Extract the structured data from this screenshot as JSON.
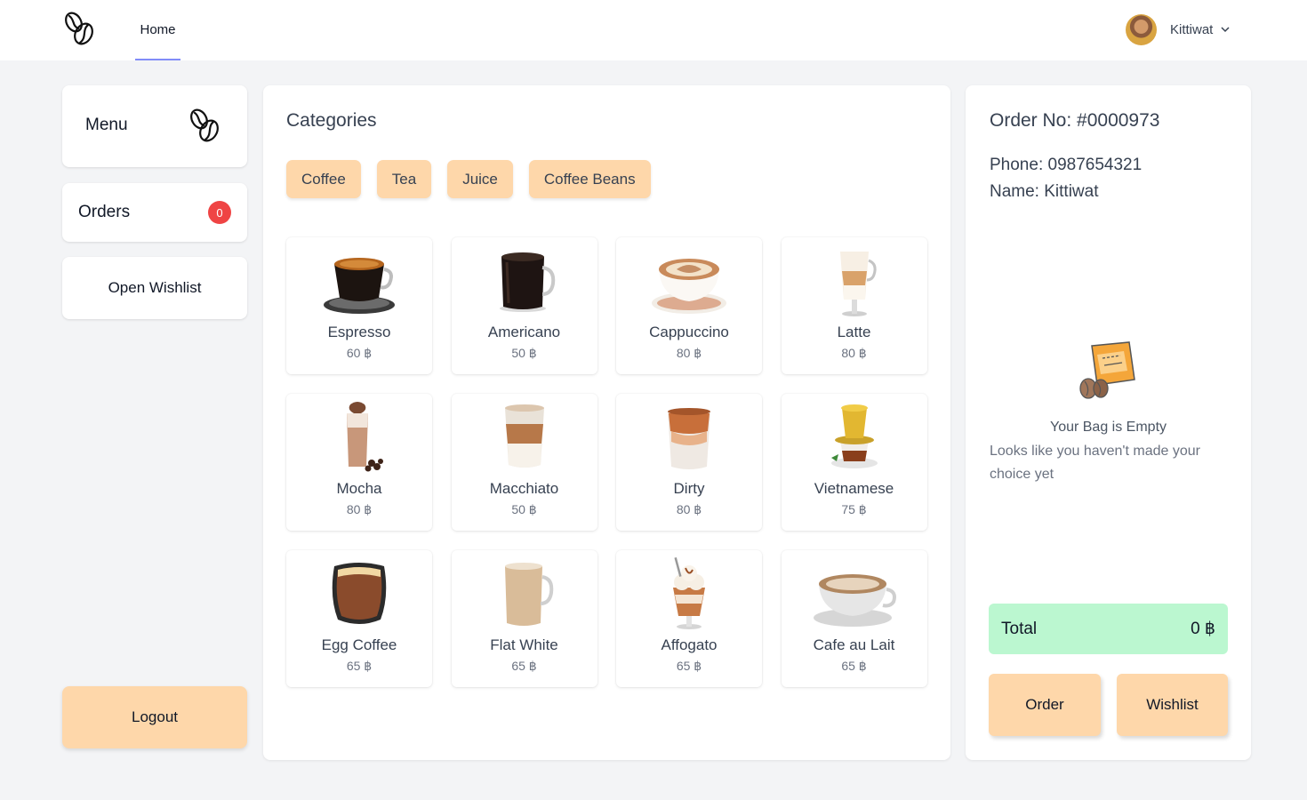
{
  "nav": {
    "home_label": "Home",
    "user_name": "Kittiwat"
  },
  "sidebar": {
    "menu_label": "Menu",
    "orders_label": "Orders",
    "orders_count": "0",
    "wishlist_label": "Open Wishlist",
    "logout_label": "Logout"
  },
  "main": {
    "categories_title": "Categories",
    "categories": [
      "Coffee",
      "Tea",
      "Juice",
      "Coffee Beans"
    ],
    "products": [
      {
        "name": "Espresso",
        "price": "60 ฿",
        "icon": "espresso-icon"
      },
      {
        "name": "Americano",
        "price": "50 ฿",
        "icon": "americano-icon"
      },
      {
        "name": "Cappuccino",
        "price": "80 ฿",
        "icon": "cappuccino-icon"
      },
      {
        "name": "Latte",
        "price": "80 ฿",
        "icon": "latte-icon"
      },
      {
        "name": "Mocha",
        "price": "80 ฿",
        "icon": "mocha-icon"
      },
      {
        "name": "Macchiato",
        "price": "50 ฿",
        "icon": "macchiato-icon"
      },
      {
        "name": "Dirty",
        "price": "80 ฿",
        "icon": "dirty-icon"
      },
      {
        "name": "Vietnamese",
        "price": "75 ฿",
        "icon": "vietnamese-icon"
      },
      {
        "name": "Egg Coffee",
        "price": "65 ฿",
        "icon": "egg-coffee-icon"
      },
      {
        "name": "Flat White",
        "price": "65 ฿",
        "icon": "flat-white-icon"
      },
      {
        "name": "Affogato",
        "price": "65 ฿",
        "icon": "affogato-icon"
      },
      {
        "name": "Cafe au Lait",
        "price": "65 ฿",
        "icon": "cafe-au-lait-icon"
      }
    ]
  },
  "order": {
    "order_no": "Order No: #0000973",
    "phone": "Phone: 0987654321",
    "name": "Name: Kittiwat",
    "empty_title": "Your Bag is Empty",
    "empty_subtitle": "Looks like you haven't made your choice yet",
    "total_label": "Total",
    "total_value": "0 ฿",
    "order_button": "Order",
    "wishlist_button": "Wishlist"
  },
  "colors": {
    "accent_peach": "#fed7aa",
    "total_green": "#bbf7d0",
    "badge_red": "#ef4444",
    "nav_underline": "#818cf8"
  }
}
